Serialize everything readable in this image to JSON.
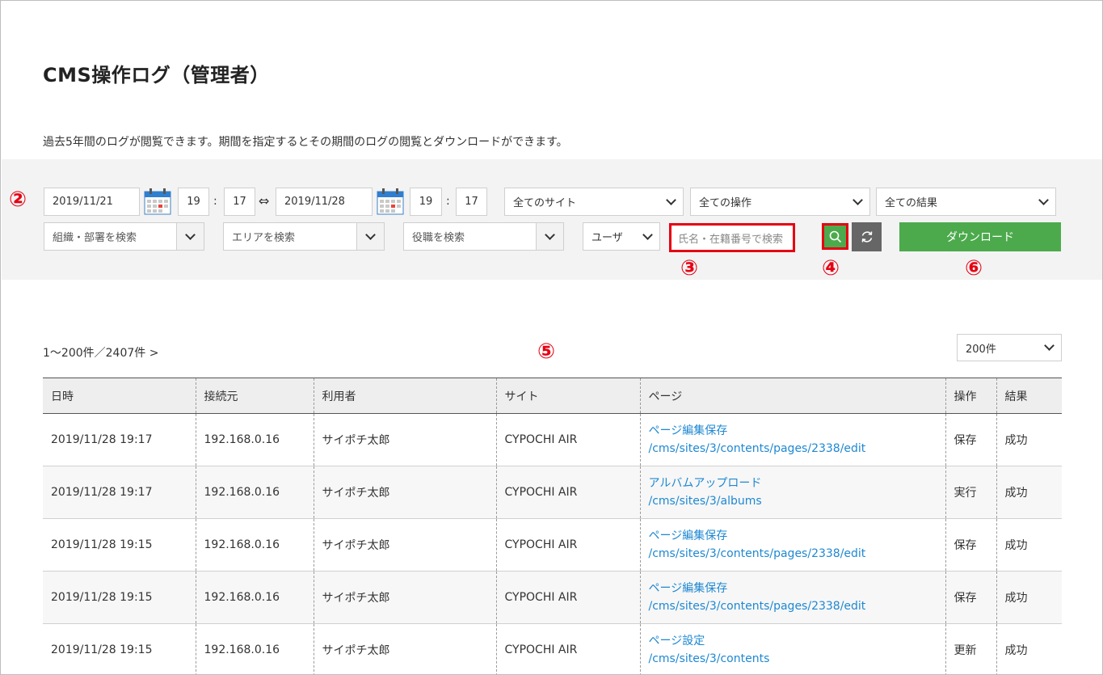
{
  "page": {
    "title": "CMS操作ログ（管理者）",
    "description": "過去5年間のログが閲覧できます。期間を指定するとその期間のログの閲覧とダウンロードができます。"
  },
  "filters": {
    "start_date": "2019/11/21",
    "start_hour": "19",
    "start_minute": "17",
    "range_arrow": "⇔",
    "time_separator": ":",
    "end_date": "2019/11/28",
    "end_hour": "19",
    "end_minute": "17",
    "site_select": "全てのサイト",
    "operation_select": "全ての操作",
    "result_select": "全ての結果",
    "org_search": "組織・部署を検索",
    "area_search": "エリアを検索",
    "position_search": "役職を検索",
    "user_type_select": "ユーザ",
    "name_search_placeholder": "氏名・在籍番号で検索",
    "download_label": "ダウンロード"
  },
  "annotations": {
    "m2": "②",
    "m3": "③",
    "m4": "④",
    "m5": "⑤",
    "m6": "⑥",
    "color": "#e60012"
  },
  "results": {
    "count_text": "1〜200件／2407件 >",
    "per_page": "200件"
  },
  "table": {
    "headers": [
      "日時",
      "接続元",
      "利用者",
      "サイト",
      "ページ",
      "操作",
      "結果"
    ],
    "rows": [
      {
        "datetime": "2019/11/28 19:17",
        "source": "192.168.0.16",
        "user": "サイポチ太郎",
        "site": "CYPOCHI AIR",
        "page_title": "ページ編集保存",
        "page_path": "/cms/sites/3/contents/pages/2338/edit",
        "operation": "保存",
        "result": "成功"
      },
      {
        "datetime": "2019/11/28 19:17",
        "source": "192.168.0.16",
        "user": "サイポチ太郎",
        "site": "CYPOCHI AIR",
        "page_title": "アルバムアップロード",
        "page_path": "/cms/sites/3/albums",
        "operation": "実行",
        "result": "成功"
      },
      {
        "datetime": "2019/11/28 19:15",
        "source": "192.168.0.16",
        "user": "サイポチ太郎",
        "site": "CYPOCHI AIR",
        "page_title": "ページ編集保存",
        "page_path": "/cms/sites/3/contents/pages/2338/edit",
        "operation": "保存",
        "result": "成功"
      },
      {
        "datetime": "2019/11/28 19:15",
        "source": "192.168.0.16",
        "user": "サイポチ太郎",
        "site": "CYPOCHI AIR",
        "page_title": "ページ編集保存",
        "page_path": "/cms/sites/3/contents/pages/2338/edit",
        "operation": "保存",
        "result": "成功"
      },
      {
        "datetime": "2019/11/28 19:15",
        "source": "192.168.0.16",
        "user": "サイポチ太郎",
        "site": "CYPOCHI AIR",
        "page_title": "ページ設定",
        "page_path": "/cms/sites/3/contents",
        "operation": "更新",
        "result": "成功"
      }
    ]
  },
  "colors": {
    "accent_green": "#4caa4c",
    "link_blue": "#1e88d2",
    "reset_gray": "#666666"
  },
  "icons": {
    "calendar": "calendar-icon",
    "search": "search-icon",
    "reset": "refresh-icon",
    "dropdown": "chevron-down-icon"
  }
}
